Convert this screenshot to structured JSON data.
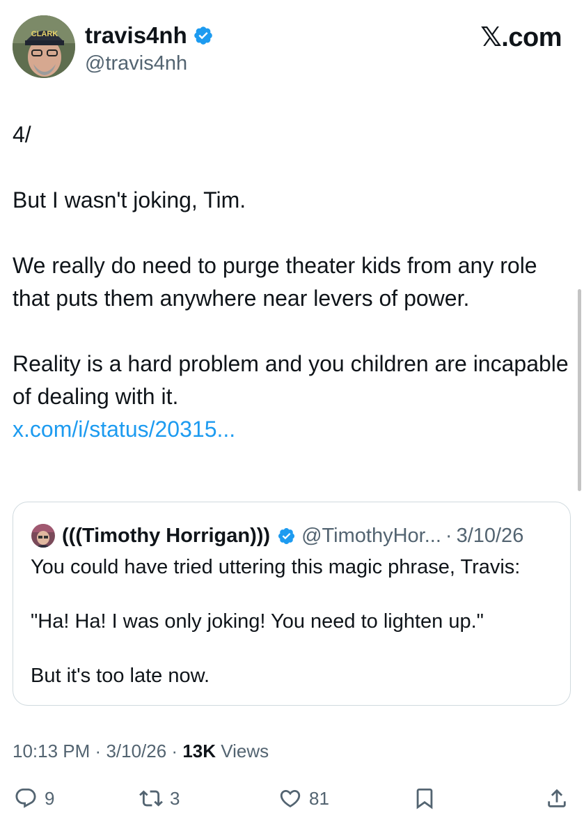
{
  "author": {
    "display_name": "travis4nh",
    "handle": "@travis4nh",
    "avatar_cap_text": "CLARK",
    "verified_color": "#1d9bf0"
  },
  "brand": {
    "logo_text": "𝕏.com"
  },
  "tweet": {
    "body": "4/\n\nBut I wasn't joking, Tim.\n\nWe really do need to purge theater kids from any role that puts them anywhere near levers of power.\n\nReality is a hard problem and you children are incapable of dealing with it.\n",
    "link_text": "x.com/i/status/20315..."
  },
  "quote": {
    "display_name": "(((Timothy Horrigan)))",
    "handle": "@TimothyHor...",
    "separator": "·",
    "date": "3/10/26",
    "text": "You could have tried uttering this magic phrase, Travis:\n\n\"Ha! Ha! I was only joking! You need to lighten up.\"\n\nBut it's too late now."
  },
  "meta": {
    "time": "10:13 PM",
    "separator": "·",
    "date": "3/10/26",
    "views_count": "13K",
    "views_label": "Views"
  },
  "actions": {
    "replies": "9",
    "reposts": "3",
    "likes": "81"
  },
  "colors": {
    "link": "#1d9bf0",
    "muted": "#536471",
    "text": "#0f1419",
    "border": "#cfd9de"
  }
}
